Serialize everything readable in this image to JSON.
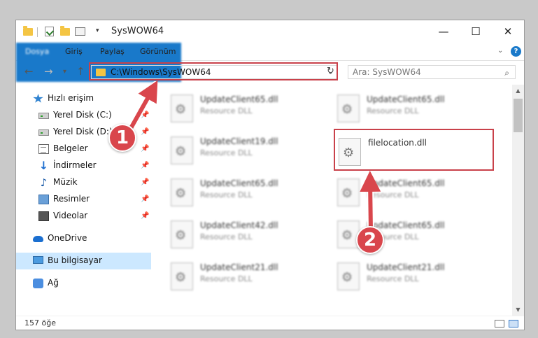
{
  "window": {
    "title": "SysWOW64",
    "controls": {
      "minimize": "—",
      "maximize": "☐",
      "close": "✕"
    }
  },
  "ribbon": {
    "tabs": [
      "Dosya",
      "Giriş",
      "Paylaş",
      "Görünüm"
    ],
    "help": "?"
  },
  "nav": {
    "back": "←",
    "forward": "→",
    "recent": "▾",
    "up": "↑",
    "address": "C:\\Windows\\SysWOW64",
    "refresh": "↻",
    "search_placeholder": "Ara: SysWOW64",
    "search_icon": "⌕"
  },
  "sidebar": {
    "items": [
      {
        "label": "Hızlı erişim",
        "icon": "star-icon",
        "pinned": false
      },
      {
        "label": "Yerel Disk (C:)",
        "icon": "disk-icon",
        "pinned": true
      },
      {
        "label": "Yerel Disk (D:)",
        "icon": "disk-icon",
        "pinned": true
      },
      {
        "label": "Belgeler",
        "icon": "documents-icon",
        "pinned": true
      },
      {
        "label": "İndirmeler",
        "icon": "download-icon",
        "pinned": true
      },
      {
        "label": "Müzik",
        "icon": "music-icon",
        "pinned": true
      },
      {
        "label": "Resimler",
        "icon": "pictures-icon",
        "pinned": true
      },
      {
        "label": "Videolar",
        "icon": "videos-icon",
        "pinned": true
      },
      {
        "label": "OneDrive",
        "icon": "cloud-icon",
        "pinned": false
      },
      {
        "label": "Bu bilgisayar",
        "icon": "computer-icon",
        "pinned": false,
        "selected": true
      },
      {
        "label": "Ağ",
        "icon": "network-icon",
        "pinned": false
      }
    ],
    "pin_glyph": "📌"
  },
  "files": [
    {
      "name": "UpdateClient65.dll",
      "type": "Resource DLL"
    },
    {
      "name": "UpdateClient65.dll",
      "type": "Resource DLL"
    },
    {
      "name": "UpdateClient19.dll",
      "type": "Resource DLL"
    },
    {
      "name": "filelocation.dll",
      "type": ""
    },
    {
      "name": "UpdateClient65.dll",
      "type": "Resource DLL"
    },
    {
      "name": "UpdateClient65.dll",
      "type": "Resource DLL"
    },
    {
      "name": "UpdateClient42.dll",
      "type": "Resource DLL"
    },
    {
      "name": "UpdateClient65.dll",
      "type": "Resource DLL"
    },
    {
      "name": "UpdateClient21.dll",
      "type": "Resource DLL"
    },
    {
      "name": "UpdateClient21.dll",
      "type": "Resource DLL"
    }
  ],
  "status": {
    "count": "157 öğe"
  },
  "callouts": [
    "1",
    "2"
  ],
  "colors": {
    "accent": "#1979ca",
    "highlight": "#c9414a",
    "badge": "#d9464c",
    "selected": "#cce8ff"
  }
}
